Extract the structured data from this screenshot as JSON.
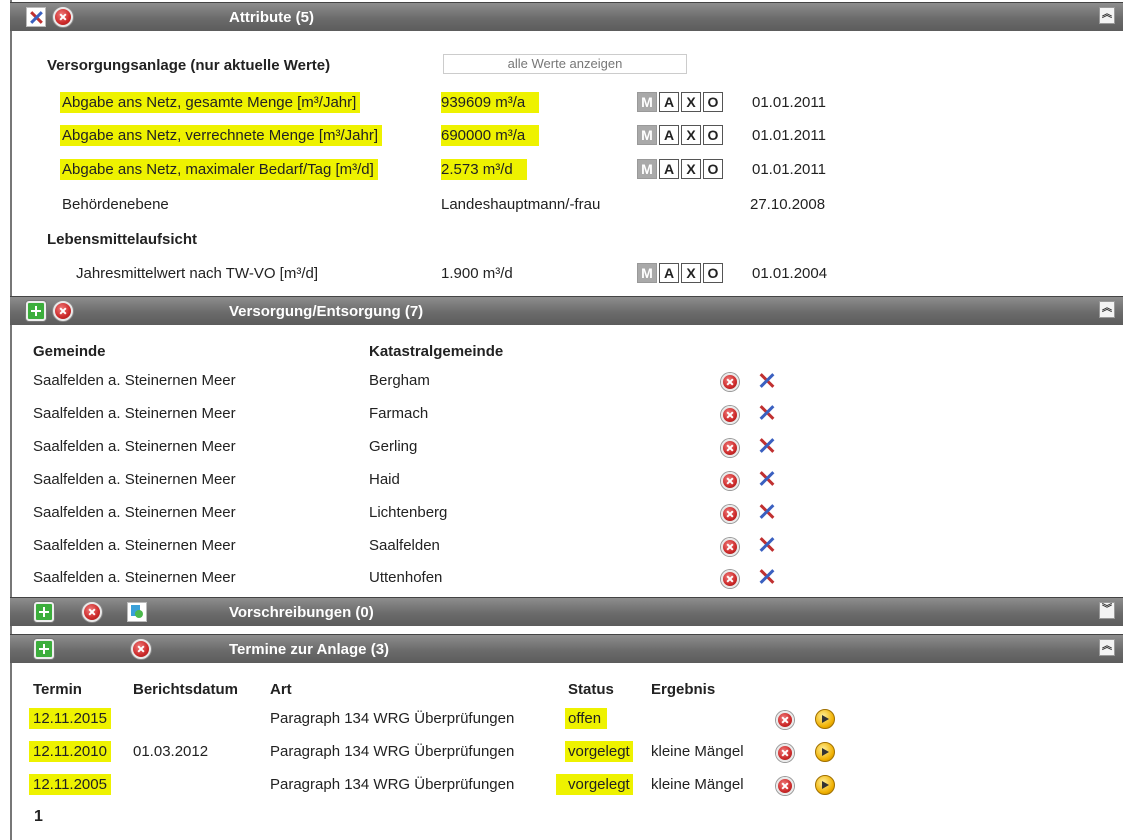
{
  "attribute": {
    "title": "Attribute (5)",
    "group1": "Versorgungsanlage (nur aktuelle Werte)",
    "show_all": "alle Werte anzeigen",
    "rows": [
      {
        "label": "Abgabe ans Netz, gesamte Menge [m³/Jahr]",
        "value": "939609 m³/a",
        "date": "01.01.2011"
      },
      {
        "label": "Abgabe ans Netz, verrechnete Menge [m³/Jahr]",
        "value": "690000 m³/a",
        "date": "01.01.2011"
      },
      {
        "label": "Abgabe ans Netz, maximaler Bedarf/Tag [m³/d]",
        "value": "2.573 m³/d",
        "date": "01.01.2011"
      },
      {
        "label": "Behördenebene",
        "value": "Landeshauptmann/-frau",
        "date": "27.10.2008"
      }
    ],
    "group2": "Lebensmittelaufsicht",
    "row5": {
      "label": "Jahresmittelwert nach TW-VO [m³/d]",
      "value": "1.900 m³/d",
      "date": "01.01.2004"
    },
    "maxo": [
      "M",
      "A",
      "X",
      "O"
    ]
  },
  "versorgung": {
    "title": "Versorgung/Entsorgung (7)",
    "col_gemeinde": "Gemeinde",
    "col_kg": "Katastralgemeinde",
    "rows": [
      {
        "gemeinde": "Saalfelden a. Steinernen Meer",
        "kg": "Bergham"
      },
      {
        "gemeinde": "Saalfelden a. Steinernen Meer",
        "kg": "Farmach"
      },
      {
        "gemeinde": "Saalfelden a. Steinernen Meer",
        "kg": "Gerling"
      },
      {
        "gemeinde": "Saalfelden a. Steinernen Meer",
        "kg": "Haid"
      },
      {
        "gemeinde": "Saalfelden a. Steinernen Meer",
        "kg": "Lichtenberg"
      },
      {
        "gemeinde": "Saalfelden a. Steinernen Meer",
        "kg": "Saalfelden"
      },
      {
        "gemeinde": "Saalfelden a. Steinernen Meer",
        "kg": "Uttenhofen"
      }
    ]
  },
  "vorschreibungen": {
    "title": "Vorschreibungen (0)"
  },
  "termine": {
    "title": "Termine zur Anlage (3)",
    "headers": {
      "termin": "Termin",
      "berichtsdatum": "Berichtsdatum",
      "art": "Art",
      "status": "Status",
      "ergebnis": "Ergebnis"
    },
    "rows": [
      {
        "termin": "12.11.2015",
        "berichtsdatum": "",
        "art": "Paragraph 134 WRG Überprüfungen",
        "status": "offen",
        "ergebnis": ""
      },
      {
        "termin": "12.11.2010",
        "berichtsdatum": "01.03.2012",
        "art": "Paragraph 134 WRG Überprüfungen",
        "status": "vorgelegt",
        "ergebnis": "kleine Mängel"
      },
      {
        "termin": "12.11.2005",
        "berichtsdatum": "",
        "art": "Paragraph 134 WRG Überprüfungen",
        "status": "vorgelegt",
        "ergebnis": "kleine Mängel"
      }
    ],
    "page": "1"
  },
  "icons": {
    "collapse_up": "chevron-double-up-icon",
    "collapse_down": "chevron-double-down-icon",
    "edit": "tools-icon",
    "delete": "delete-icon",
    "add": "add-icon",
    "copy": "copy-icon",
    "go": "arrow-right-icon"
  },
  "colors": {
    "highlight": "#eef200",
    "bar": "#6b6b6b"
  }
}
